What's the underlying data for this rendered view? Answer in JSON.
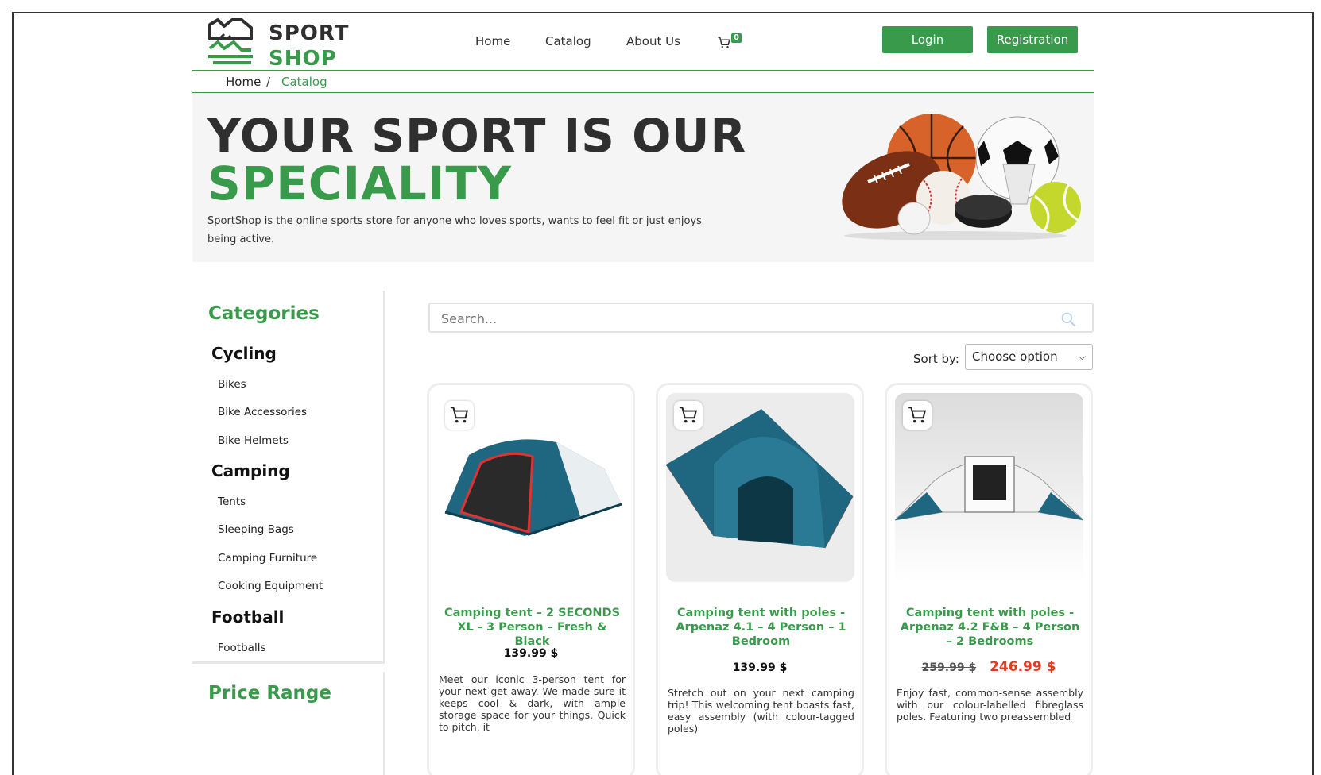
{
  "brand": {
    "line1": "SPORT",
    "line2": "SHOP"
  },
  "nav": {
    "home": "Home",
    "catalog": "Catalog",
    "about": "About Us",
    "cart_count": "0"
  },
  "auth": {
    "login": "Login",
    "register": "Registration"
  },
  "breadcrumb": {
    "home": "Home",
    "separator": "/",
    "current": "Catalog"
  },
  "hero": {
    "line1": "YOUR SPORT IS OUR",
    "line2": "SPECIALITY",
    "description": "SportShop is the online sports store for anyone who loves sports, wants to feel fit or just enjoys being active."
  },
  "sidebar": {
    "title": "Categories",
    "groups": [
      {
        "name": "Cycling",
        "items": [
          "Bikes",
          "Bike Accessories",
          "Bike Helmets"
        ]
      },
      {
        "name": "Camping",
        "items": [
          "Tents",
          "Sleeping Bags",
          "Camping Furniture",
          "Cooking Equipment"
        ]
      },
      {
        "name": "Football",
        "items": [
          "Footballs"
        ]
      }
    ],
    "price_title": "Price Range"
  },
  "search": {
    "placeholder": "Search..."
  },
  "sort": {
    "label": "Sort by:",
    "selected": "Choose option"
  },
  "products": [
    {
      "title": "Camping tent – 2 SECONDS XL - 3 Person – Fresh & Black",
      "price": "139.99 $",
      "description": "Meet our iconic 3-person tent for your next get away. We made sure it keeps cool & dark, with ample storage space for your things. Quick to pitch, it"
    },
    {
      "title": "Camping tent with poles - Arpenaz 4.1 – 4 Person – 1 Bedroom",
      "price": "139.99 $",
      "description": "Stretch out on your next camping trip! This welcoming tent boasts fast, easy assembly (with colour-tagged poles)"
    },
    {
      "title": "Camping tent with poles - Arpenaz 4.2 F&B – 4 Person – 2 Bedrooms",
      "old_price": "259.99 $",
      "price": "246.99 $",
      "description": "Enjoy fast, common-sense assembly with our colour-labelled fibreglass poles. Featuring two preassembled"
    }
  ],
  "colors": {
    "accent": "#3a9a4b",
    "sale": "#e53a1f",
    "dark": "#2f2f2f"
  }
}
